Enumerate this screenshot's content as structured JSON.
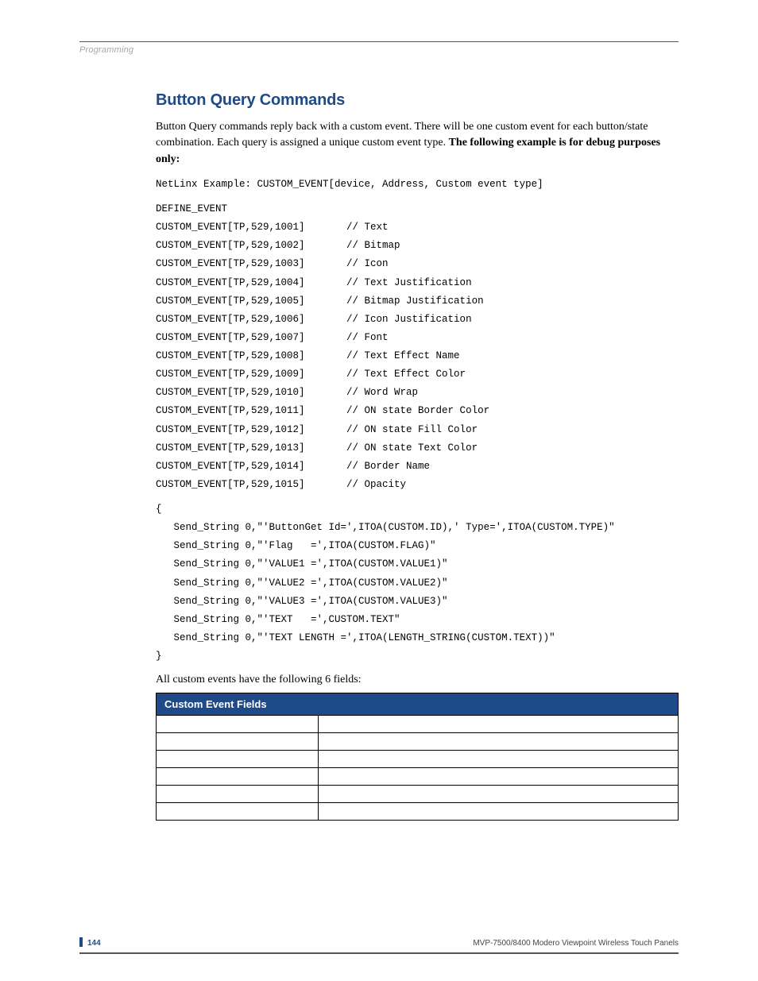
{
  "header": {
    "label": "Programming"
  },
  "section": {
    "title": "Button Query Commands",
    "intro_plain": "Button Query commands reply back with a custom event. There will be one custom event for each button/state combination. Each query is assigned a unique custom event type. ",
    "intro_bold": "The following example is for debug purposes only:"
  },
  "code": {
    "line_example": "NetLinx Example: CUSTOM_EVENT[device, Address, Custom event type]",
    "define_event": "DEFINE_EVENT",
    "events": [
      {
        "call": "CUSTOM_EVENT[TP,529,1001]",
        "comment": "// Text"
      },
      {
        "call": "CUSTOM_EVENT[TP,529,1002]",
        "comment": "// Bitmap"
      },
      {
        "call": "CUSTOM_EVENT[TP,529,1003]",
        "comment": "// Icon"
      },
      {
        "call": "CUSTOM_EVENT[TP,529,1004]",
        "comment": "// Text Justification"
      },
      {
        "call": "CUSTOM_EVENT[TP,529,1005]",
        "comment": "// Bitmap Justification"
      },
      {
        "call": "CUSTOM_EVENT[TP,529,1006]",
        "comment": "// Icon Justification"
      },
      {
        "call": "CUSTOM_EVENT[TP,529,1007]",
        "comment": "// Font"
      },
      {
        "call": "CUSTOM_EVENT[TP,529,1008]",
        "comment": "// Text Effect Name"
      },
      {
        "call": "CUSTOM_EVENT[TP,529,1009]",
        "comment": "// Text Effect Color"
      },
      {
        "call": "CUSTOM_EVENT[TP,529,1010]",
        "comment": "// Word Wrap"
      },
      {
        "call": "CUSTOM_EVENT[TP,529,1011]",
        "comment": "// ON state Border Color"
      },
      {
        "call": "CUSTOM_EVENT[TP,529,1012]",
        "comment": "// ON state Fill Color"
      },
      {
        "call": "CUSTOM_EVENT[TP,529,1013]",
        "comment": "// ON state Text Color"
      },
      {
        "call": "CUSTOM_EVENT[TP,529,1014]",
        "comment": "// Border Name"
      },
      {
        "call": "CUSTOM_EVENT[TP,529,1015]",
        "comment": "// Opacity"
      }
    ],
    "block_open": "{",
    "body": [
      "   Send_String 0,\"'ButtonGet Id=',ITOA(CUSTOM.ID),' Type=',ITOA(CUSTOM.TYPE)\"",
      "   Send_String 0,\"'Flag   =',ITOA(CUSTOM.FLAG)\"",
      "   Send_String 0,\"'VALUE1 =',ITOA(CUSTOM.VALUE1)\"",
      "   Send_String 0,\"'VALUE2 =',ITOA(CUSTOM.VALUE2)\"",
      "   Send_String 0,\"'VALUE3 =',ITOA(CUSTOM.VALUE3)\"",
      "   Send_String 0,\"'TEXT   =',CUSTOM.TEXT\"",
      "   Send_String 0,\"'TEXT LENGTH =',ITOA(LENGTH_STRING(CUSTOM.TEXT))\""
    ],
    "block_close": "}"
  },
  "outro": "All custom events have the following 6 fields:",
  "table": {
    "header": "Custom Event Fields",
    "rows": [
      {
        "c1": "",
        "c2": ""
      },
      {
        "c1": "",
        "c2": ""
      },
      {
        "c1": "",
        "c2": ""
      },
      {
        "c1": "",
        "c2": ""
      },
      {
        "c1": "",
        "c2": ""
      },
      {
        "c1": "",
        "c2": ""
      }
    ]
  },
  "footer": {
    "page_number": "144",
    "doc_title": "MVP-7500/8400 Modero Viewpoint Wireless Touch Panels"
  }
}
